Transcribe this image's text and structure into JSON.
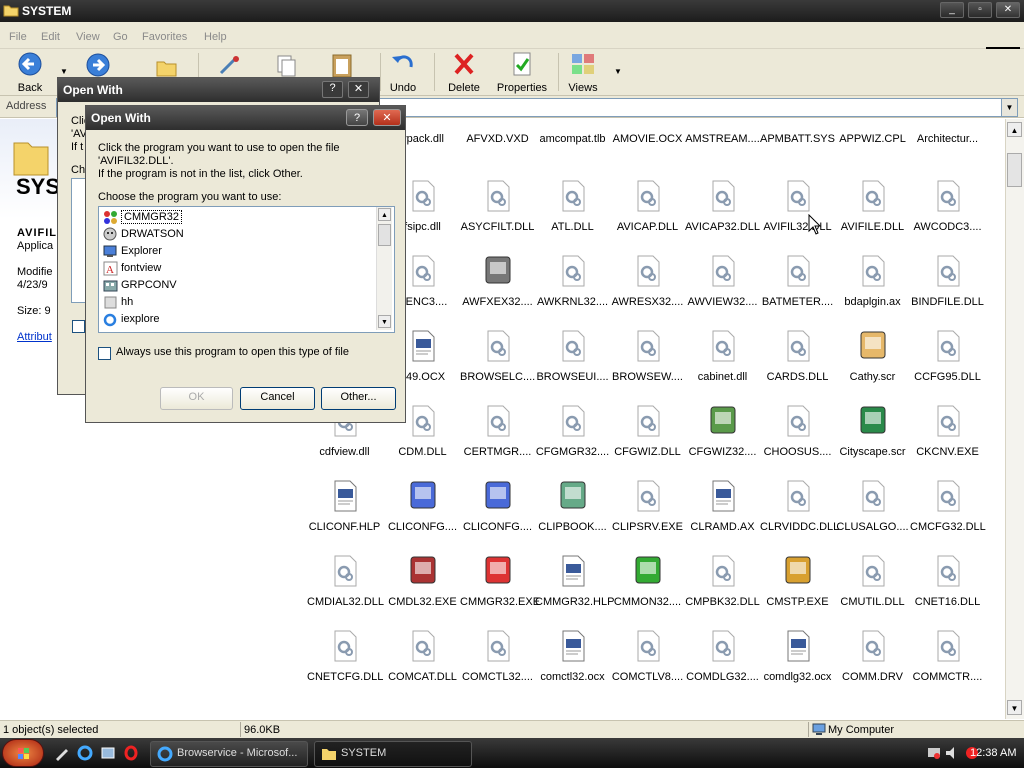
{
  "window": {
    "title": "SYSTEM",
    "controls": [
      "_",
      "▫",
      "✕"
    ]
  },
  "menu": [
    "File",
    "Edit",
    "View",
    "Go",
    "Favorites",
    "Help"
  ],
  "toolbar": {
    "back": "Back",
    "undo": "Undo",
    "delete": "Delete",
    "properties": "Properties",
    "views": "Views"
  },
  "address": {
    "label": "Address"
  },
  "leftpane": {
    "title": "SYS",
    "filename": "AVIFIL",
    "type": "Applica",
    "modified_label": "Modifie",
    "modified_date": "4/23/9",
    "size": "Size: 9",
    "attributes": "Attribut",
    "bg_items": [
      "Clic",
      "'AV",
      "If t",
      "Ch"
    ]
  },
  "files": [
    "vpack.dll",
    "AFVXD.VXD",
    "amcompat.tlb",
    "AMOVIE.OCX",
    "AMSTREAM....",
    "APMBATT.SYS",
    "APPWIZ.CPL",
    "Architectur...",
    "fsipc.dll",
    "ASYCFILT.DLL",
    "ATL.DLL",
    "AVICAP.DLL",
    "AVICAP32.DLL",
    "AVIFIL32.DLL",
    "AVIFILE.DLL",
    "AWCODC3....",
    "DENC3....",
    "AWFXEX32....",
    "AWKRNL32....",
    "AWRESX32....",
    "AWVIEW32....",
    "BATMETER....",
    "bdaplgin.ax",
    "BINDFILE.DLL",
    "549.OCX",
    "BROWSELC....",
    "BROWSEUI....",
    "BROWSEW....",
    "cabinet.dll",
    "CARDS.DLL",
    "Cathy.scr",
    "CCFG95.DLL",
    "cdfview.dll",
    "CDM.DLL",
    "CERTMGR....",
    "CFGMGR32....",
    "CFGWIZ.DLL",
    "CFGWIZ32....",
    "CHOOSUS....",
    "Cityscape.scr",
    "CKCNV.EXE",
    "CLICONF.HLP",
    "CLICONFG....",
    "CLICONFG....",
    "CLIPBOOK....",
    "CLIPSRV.EXE",
    "CLRAMD.AX",
    "CLRVIDDC.DLL",
    "CLUSALGO....",
    "CMCFG32.DLL",
    "CMDIAL32.DLL",
    "CMDL32.EXE",
    "CMMGR32.EXE",
    "CMMGR32.HLP",
    "CMMON32....",
    "CMPBK32.DLL",
    "CMSTP.EXE",
    "CMUTIL.DLL",
    "CNET16.DLL",
    "CNETCFG.DLL",
    "COMCAT.DLL",
    "COMCTL32....",
    "comctl32.ocx",
    "COMCTLV8....",
    "COMDLG32....",
    "comdlg32.ocx",
    "COMM.DRV",
    "COMMCTR...."
  ],
  "status": {
    "selected": "1 object(s) selected",
    "size": "96.0KB",
    "location": "My Computer"
  },
  "taskbar": {
    "task1": "Browservice - Microsof...",
    "task2": "SYSTEM",
    "clock": "12:38 AM"
  },
  "dialog_back": {
    "title": "Open With"
  },
  "dialog": {
    "title": "Open With",
    "help": "?",
    "close": "✕",
    "line1": "Click the program you want to use to open the file",
    "line2": "'AVIFIL32.DLL'.",
    "line3": "If the program is not in the list, click Other.",
    "choose_label": "Choose the program you want to use:",
    "programs": [
      "CMMGR32",
      "DRWATSON",
      "Explorer",
      "fontview",
      "GRPCONV",
      "hh",
      "iexplore"
    ],
    "always_label": "Always use this program to open this type of file",
    "ok": "OK",
    "cancel": "Cancel",
    "other": "Other..."
  },
  "colors": {
    "dialog_bg": "#ece9d8",
    "titlebar": "#2e2e2e",
    "link": "#0033cc",
    "selection_border": "#000000"
  }
}
